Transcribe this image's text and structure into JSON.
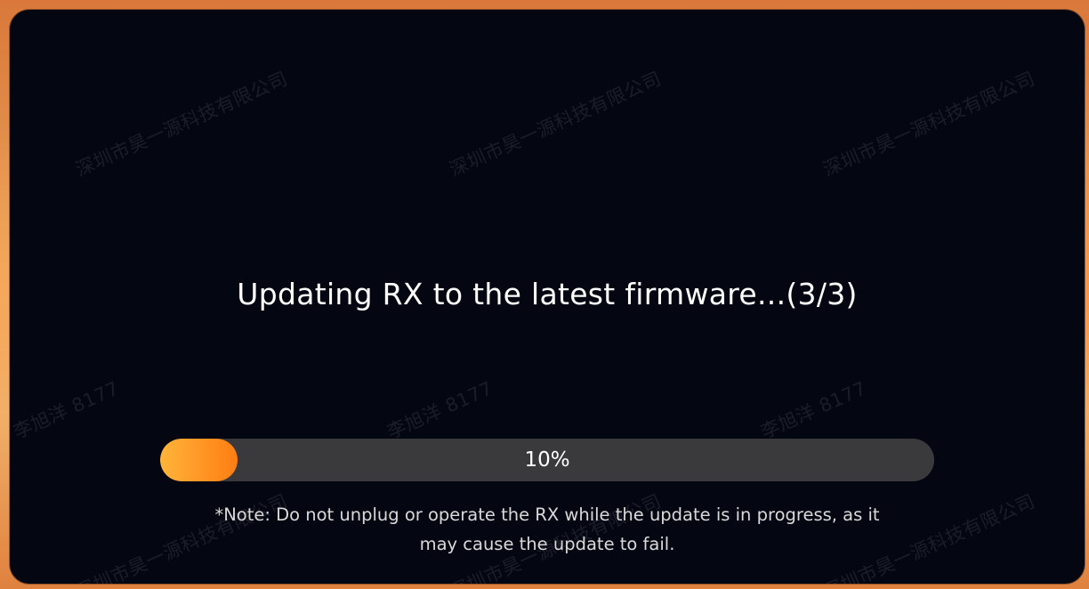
{
  "dialog": {
    "title": "Updating RX to the latest firmware...(3/3)",
    "progress": {
      "value": 0.1,
      "label": "10%"
    },
    "note_line1": "*Note: Do not unplug or operate the RX while the update is in progress, as it",
    "note_line2": "may cause the update to fail."
  },
  "watermark": {
    "company": "深圳市昊一源科技有限公司",
    "user": "李旭洋 8177"
  },
  "colors": {
    "dialog_background": "#040712",
    "progress_track": "#3a3a3c",
    "progress_fill_start": "#ffb43a",
    "progress_fill_end": "#ff7d12",
    "frame_orange": "#e9a15a"
  }
}
